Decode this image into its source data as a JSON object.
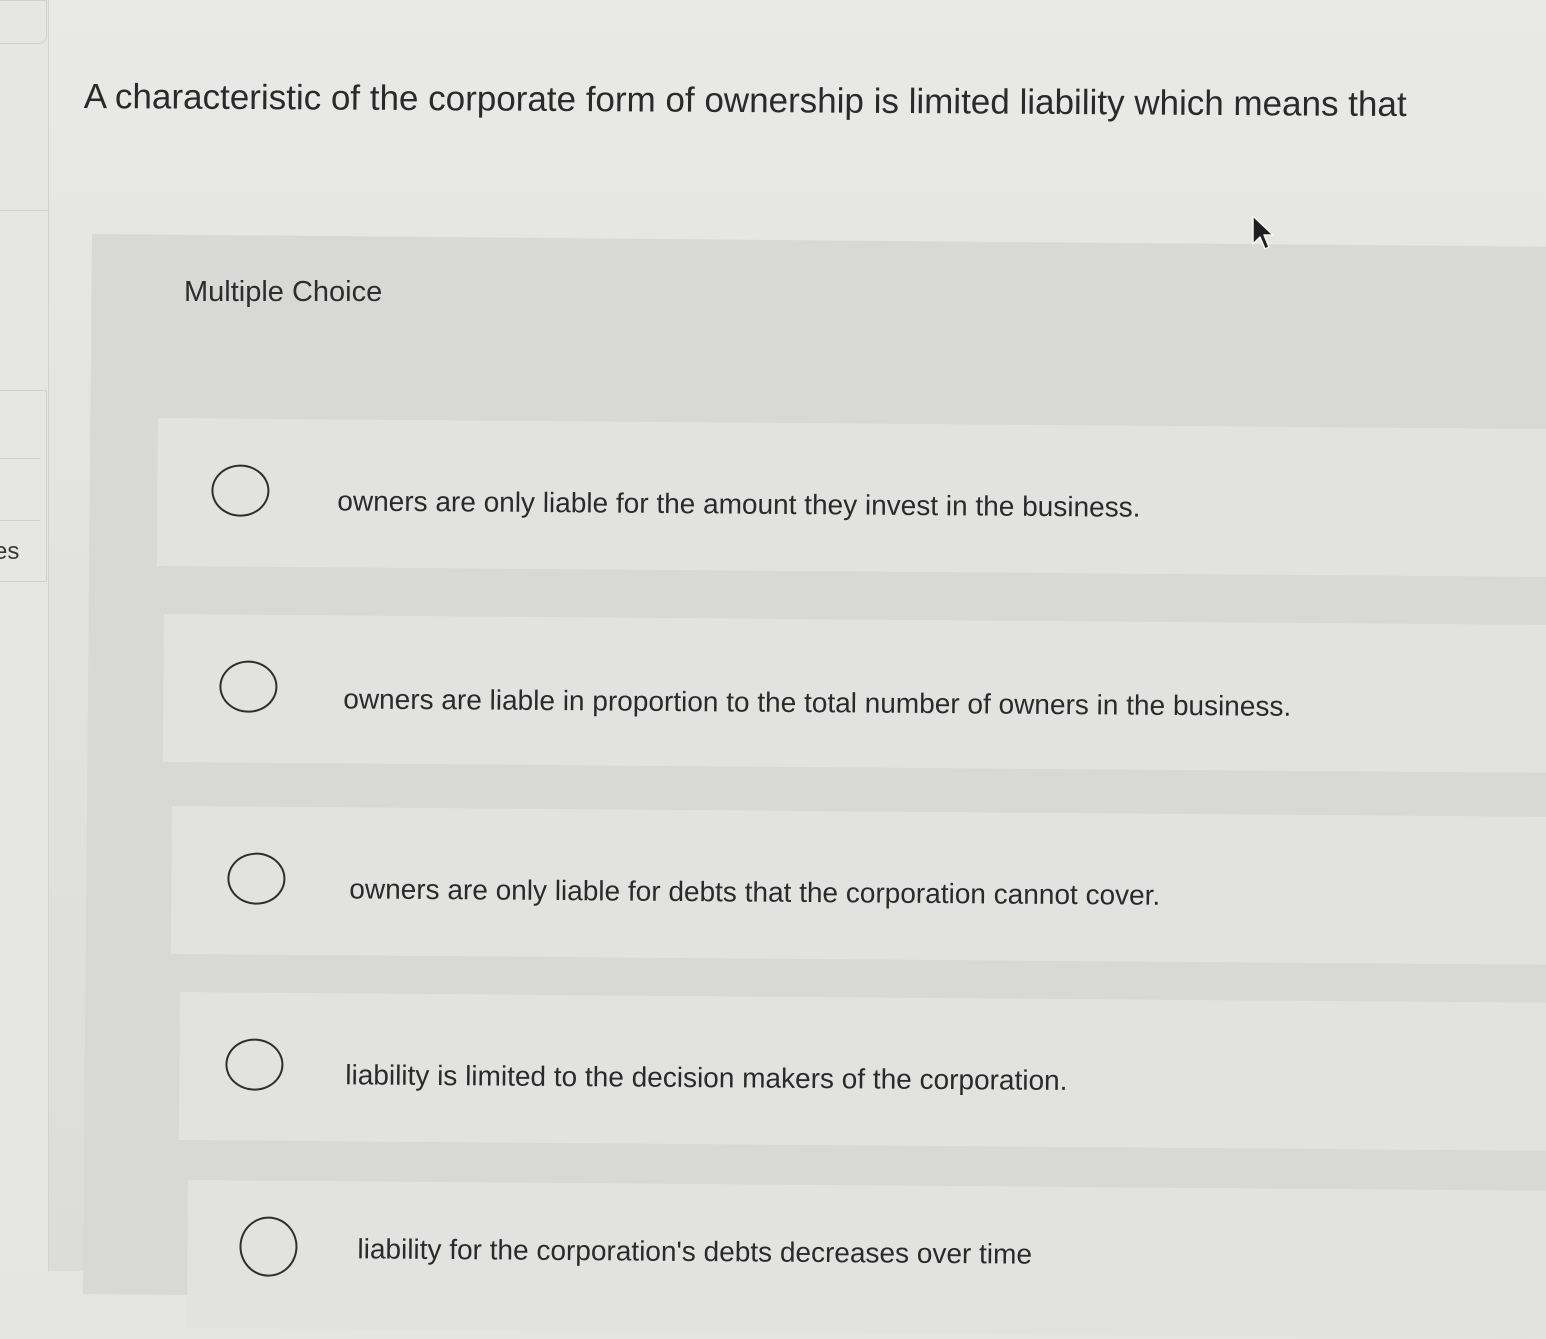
{
  "sidebar": {
    "partial_label": "es"
  },
  "question": {
    "prompt": "A characteristic of the corporate form of ownership is limited liability which means that"
  },
  "answer_panel": {
    "title": "Multiple Choice",
    "options": [
      {
        "label": "owners are only liable for the amount they invest in the business.",
        "selected": false
      },
      {
        "label": "owners are liable in proportion to the total number of owners in the business.",
        "selected": false
      },
      {
        "label": "owners are only liable for debts that the corporation cannot cover.",
        "selected": false
      },
      {
        "label": "liability is limited to the decision makers of the corporation.",
        "selected": false
      },
      {
        "label": "liability for the corporation's debts decreases over time",
        "selected": false
      }
    ]
  },
  "icons": {
    "cursor": "mouse-pointer-icon",
    "radio": "radio-unchecked-icon"
  },
  "colors": {
    "background": "#e4e4e2",
    "panel": "#d8d8d6",
    "option_row": "#e2e2e0",
    "text": "#2a2a2c"
  }
}
